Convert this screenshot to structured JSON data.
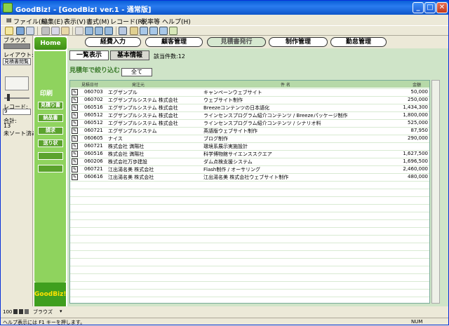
{
  "window": {
    "title": "GoodBiz! - [GoodBiz! ver.1 - 通常版]"
  },
  "menu": [
    "ファイル(F)",
    "編集(E)",
    "表示(V)",
    "書式(M)",
    "レコード(R)",
    "税率等",
    "ヘルプ(H)"
  ],
  "left": {
    "browse": "ブラウズ",
    "layout_label": "レイアウト:",
    "layout_value": "見積書閲覧",
    "record_label": "レコード:",
    "record_value": "9",
    "total_label": "合計:",
    "total_value": "13",
    "sort_status": "未ソート済み"
  },
  "sidebar": {
    "home": "Home",
    "print": "印刷",
    "buttons": [
      "見積り書",
      "納品書",
      "請求",
      "送り状"
    ],
    "logo": "GoodBiz!"
  },
  "nav": {
    "tabs": [
      "経費入力",
      "顧客管理",
      "見積書発行",
      "制作管理",
      "勤怠管理"
    ]
  },
  "subtabs": {
    "list": "一覧表示",
    "detail": "基本情報",
    "count": "該当件数:12"
  },
  "filter": {
    "label": "見積年で絞り込む",
    "value": "全て"
  },
  "table": {
    "headers": [
      "見積日付",
      "発注元",
      "件 名",
      "金額"
    ],
    "rows": [
      [
        "060703",
        "エグザンプル",
        "キャンペーンウェブサイト",
        "50,000"
      ],
      [
        "060702",
        "エグザンプルシステム 株式会社",
        "ウェブサイト制作",
        "250,000"
      ],
      [
        "060516",
        "エグザンプルシステム 株式会社",
        "Breezeコンテンツの日本語化",
        "1,434,300"
      ],
      [
        "060512",
        "エグザンプルシステム 株式会社",
        "ラインセンスプログラム紹介コンテンツ / Breezeパッケージ制作",
        "1,800,000"
      ],
      [
        "060512",
        "エグザンプルシステム 株式会社",
        "ラインセンスプログラム紹介コンテンツ / シナリオ料",
        "525,000"
      ],
      [
        "060721",
        "エグザンプルシステム",
        "英語版ウェブサイト制作",
        "87,950"
      ],
      [
        "060605",
        "ナイス",
        "ブログ制作",
        "290,000"
      ],
      [
        "060721",
        "株式会社 満陽社",
        "環境系展示実施設計",
        ""
      ],
      [
        "060516",
        "株式会社 満陽社",
        "科学博物館サイエンススクエア",
        "1,627,500"
      ],
      [
        "060206",
        "株式会社万歩建設",
        "ダム点検支援システム",
        "1,696,500"
      ],
      [
        "060721",
        "江出湯名美 株式会社",
        "Flash制作 / オーサリング",
        "2,460,000"
      ],
      [
        "060616",
        "江出湯名美 株式会社",
        "江出湯名美 株式会社ウェブサイト制作",
        "480,000"
      ]
    ]
  },
  "bottom": {
    "zoom": "100",
    "mode": "ブラウズ"
  },
  "status": {
    "help": "ヘルプ表示には F1 キーを押します。",
    "num": "NUM"
  }
}
